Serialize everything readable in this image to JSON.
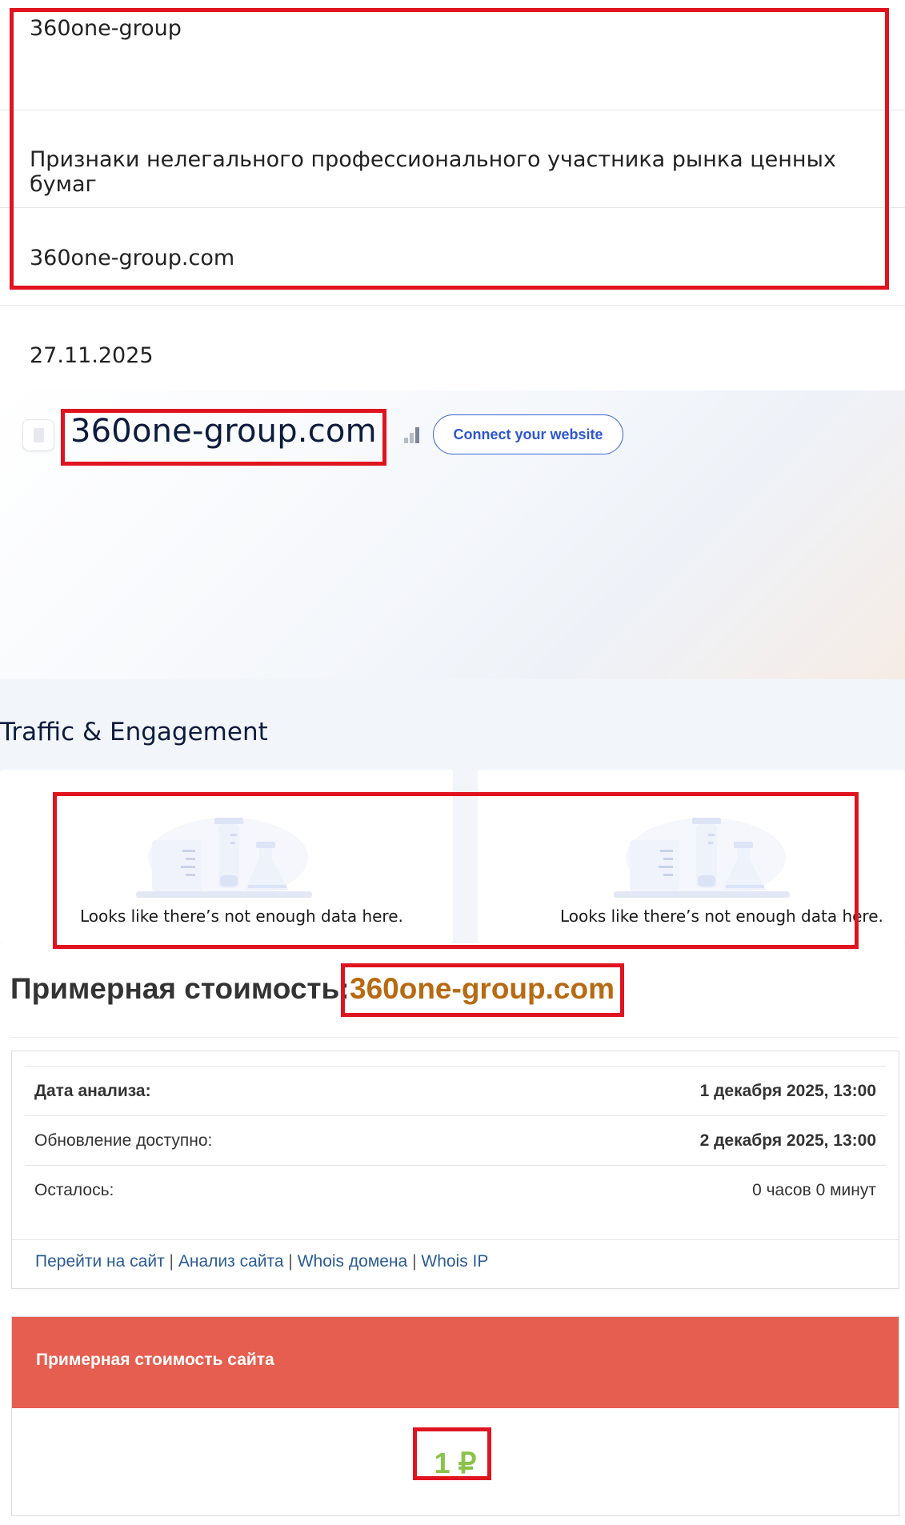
{
  "top_list": {
    "name": "360one-group",
    "reason": "Признаки нелегального профессионального участника рынка ценных бумаг",
    "domain": "360one-group.com",
    "date": "27.11.2025"
  },
  "site_header": {
    "title": "360one-group.com",
    "connect_button": "Connect your website"
  },
  "traffic": {
    "title": "Traffic & Engagement",
    "cards": [
      {
        "message": "Looks like there’s not enough data here."
      },
      {
        "message": "Looks like there’s not enough data here."
      }
    ]
  },
  "cost": {
    "heading": "Примерная стоимость:",
    "domain": "360one-group.com",
    "rows": [
      {
        "label": "Дата анализа:",
        "value": "1 декабря 2025, 13:00"
      },
      {
        "label": "Обновление доступно:",
        "value": "2 декабря 2025, 13:00"
      },
      {
        "label": "Осталось:",
        "value": "0 часов 0 минут"
      }
    ],
    "links": [
      "Перейти на сайт",
      "Анализ сайта",
      "Whois домена",
      "Whois IP"
    ],
    "links_separator": "|",
    "value_card": {
      "title": "Примерная стоимость сайта",
      "price": "1 ₽"
    }
  },
  "colors": {
    "highlight_border": "#e0141f",
    "accent_blue": "#2e57d2",
    "cost_domain": "#b86a12",
    "value_header": "#e65e50",
    "price_green": "#8bc34a"
  }
}
